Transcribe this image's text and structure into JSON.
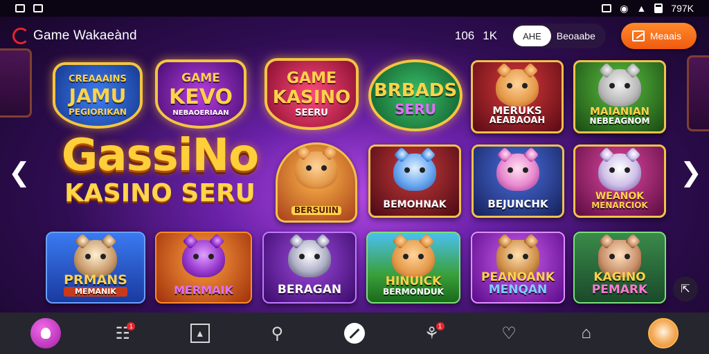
{
  "status": {
    "right_text": "797K"
  },
  "header": {
    "app_title": "Game Wakaeànd",
    "stat_1": "106",
    "stat_2": "1K",
    "pill_left": "AHE",
    "pill_right": "Beoaabe",
    "cta_label": "Meaais"
  },
  "hero": {
    "title": "GassiNo",
    "subtitle": "KASINO SERU"
  },
  "badges": [
    {
      "l1": "CREAAAINS",
      "l2": "JAMU",
      "l3": "PEGIORIKAN",
      "color": "#2a6be0"
    },
    {
      "l1": "GAME",
      "l2": "KEVO",
      "l3": "NEBAOERIAAN",
      "color": "#7a1aa8"
    },
    {
      "l1": "GAME",
      "l2": "KASINO",
      "l3": "SEERU",
      "color": "#d62a5e"
    },
    {
      "l1": "",
      "l2": "BRBADS",
      "l3": "SERU",
      "color": "#1e8c4a"
    }
  ],
  "tiles_top": [
    {
      "l1": "MERUKS",
      "l2": "AEABAOAH",
      "bg": "#8a1a2a"
    },
    {
      "l1": "MAIANIAN",
      "l2": "NEBEAGNOM",
      "bg": "#2e7a22"
    }
  ],
  "tiles_mid": [
    {
      "l1": "BERSUIIN",
      "l2": "",
      "bg": "#7a1fb0"
    },
    {
      "l1": "BEMOHNAK",
      "l2": "",
      "bg": "#8a1a2a"
    },
    {
      "l1": "BEJUNCHK",
      "l2": "",
      "bg": "#2a3fb0"
    },
    {
      "l1": "WEANOK",
      "l2": "MENARCIOK",
      "bg": "#a81a6a"
    }
  ],
  "tiles_bottom": [
    {
      "l1": "PRMANS",
      "l2": "MEMANIK",
      "bg": "#2a5ad0"
    },
    {
      "l1": "MERMAIK",
      "l2": "",
      "bg": "#c2401a"
    },
    {
      "l1": "BERAGAN",
      "l2": "",
      "bg": "#7a1fb0"
    },
    {
      "l1": "HINUICK",
      "l2": "BERMONDUK",
      "bg": "#2e8a2a"
    },
    {
      "l1": "PEANOANK",
      "l2": "MENQAN",
      "bg": "#8a1fb0"
    },
    {
      "l1": "KAGINO",
      "l2": "PEMARK",
      "bg": "#2a7a3a"
    }
  ],
  "nav": {
    "badge_count_1": "1",
    "badge_count_2": "1"
  },
  "icons": [
    "search-icon",
    "home-icon",
    "cart-icon",
    "compass-icon",
    "chevron-left-icon",
    "chevron-right-icon"
  ]
}
